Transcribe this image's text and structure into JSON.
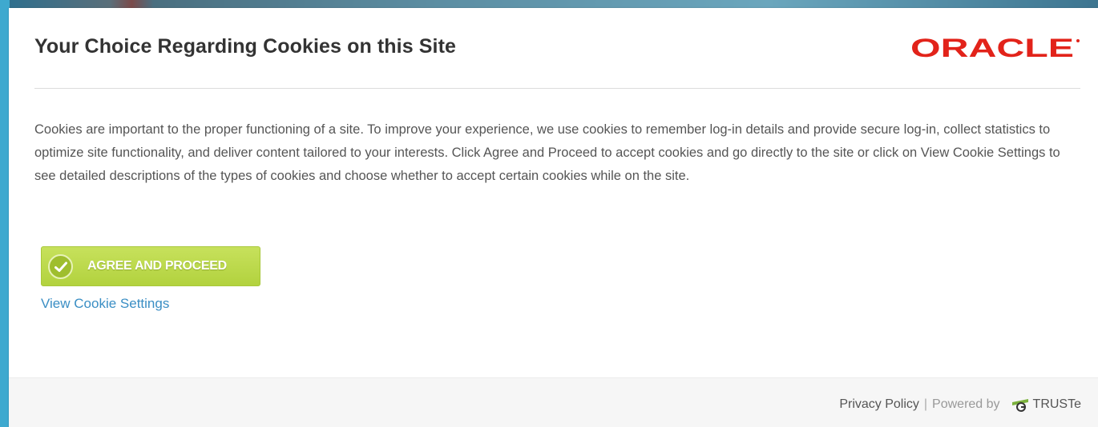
{
  "modal": {
    "title": "Your Choice Regarding Cookies on this Site",
    "logo_text": "ORACLE",
    "body": "Cookies are important to the proper functioning of a site. To improve your experience, we use cookies to remember log-in details and provide secure log-in, collect statistics to optimize site functionality, and deliver content tailored to your interests. Click Agree and Proceed to accept cookies and go directly to the site or click on View Cookie Settings to see detailed descriptions of the types of cookies and choose whether to accept certain cookies while on the site.",
    "agree_button_label": "AGREE AND PROCEED",
    "settings_link_label": "View Cookie Settings"
  },
  "footer": {
    "privacy_policy": "Privacy Policy",
    "separator": "|",
    "powered_by": "Powered by",
    "truste": "TRUSTe"
  },
  "colors": {
    "oracle_red": "#e2231a",
    "agree_green": "#b7d545",
    "link_blue": "#3a8ec4"
  },
  "icons": {
    "agree": "check-circle-icon",
    "truste": "truste-seal-icon"
  }
}
